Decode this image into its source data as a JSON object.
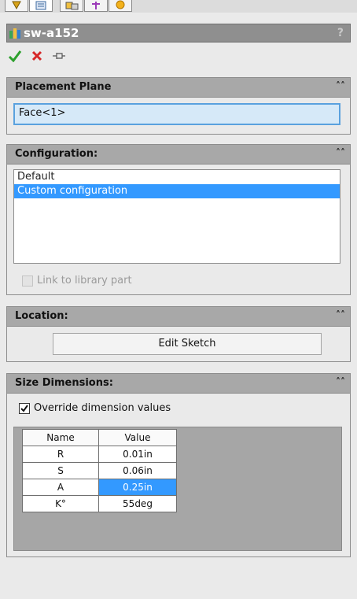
{
  "title": "sw-a152",
  "help_label": "?",
  "placement_plane": {
    "header": "Placement Plane",
    "value": "Face<1>"
  },
  "configuration": {
    "header": "Configuration:",
    "items": [
      "Default",
      "Custom configuration"
    ],
    "selected_index": 1,
    "link_label": "Link to library part",
    "link_checked": false
  },
  "location": {
    "header": "Location:",
    "edit_sketch_label": "Edit Sketch"
  },
  "size_dimensions": {
    "header": "Size Dimensions:",
    "override_label": "Override dimension values",
    "override_checked": true,
    "columns": [
      "Name",
      "Value"
    ],
    "rows": [
      {
        "name": "R",
        "value": "0.01in"
      },
      {
        "name": "S",
        "value": "0.06in"
      },
      {
        "name": "A",
        "value": "0.25in"
      },
      {
        "name": "K°",
        "value": "55deg"
      }
    ],
    "selected_row": 2
  },
  "colors": {
    "selection": "#3399ff",
    "header_bg": "#a8a8a8",
    "title_bg": "#8f8f8f",
    "ok_green": "#2ca02c",
    "cancel_red": "#d62728"
  },
  "icons": {
    "ok": "check-icon",
    "cancel": "x-icon",
    "pin": "pushpin-icon",
    "collapse": "double-chevron-up-icon",
    "app": "library-feature-icon"
  }
}
